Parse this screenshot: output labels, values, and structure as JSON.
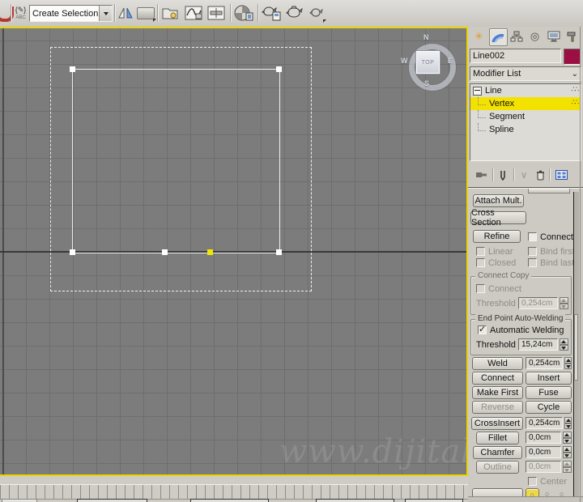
{
  "toolbar": {
    "selection_set_value": "Create Selection Se"
  },
  "viewport": {
    "viewcube": {
      "center": "TOP",
      "north": "N",
      "east": "E",
      "south": "S",
      "west": "W"
    },
    "watermark": "www.dijitalde"
  },
  "panel": {
    "object_name": "Line002",
    "object_color": "#9b0f42",
    "modifier_list": "Modifier List",
    "stack": {
      "root": "Line",
      "items": [
        {
          "label": "Vertex"
        },
        {
          "label": "Segment"
        },
        {
          "label": "Spline"
        }
      ],
      "selected": "Vertex"
    },
    "rollout": {
      "attach_mult": "Attach Mult.",
      "cross_section": "Cross Section",
      "refine": "Refine",
      "connect_checkbox": "Connect",
      "linear": "Linear",
      "closed": "Closed",
      "bind_first": "Bind first",
      "bind_last": "Bind last",
      "connect_copy": {
        "title": "Connect Copy",
        "connect": "Connect",
        "threshold": "Threshold",
        "value": "0,254cm"
      },
      "auto_weld": {
        "title": "End Point Auto-Welding",
        "checkbox": "Automatic Welding",
        "threshold": "Threshold",
        "value": "15,24cm"
      },
      "weld": "Weld",
      "weld_value": "0,254cm",
      "connect_button": "Connect",
      "insert": "Insert",
      "make_first": "Make First",
      "fuse": "Fuse",
      "reverse": "Reverse",
      "cycle": "Cycle",
      "cross_insert": "CrossInsert",
      "cross_insert_value": "0,254cm",
      "fillet": "Fillet",
      "fillet_value": "0,0cm",
      "chamfer": "Chamfer",
      "chamfer_value": "0,0cm",
      "outline": "Outline",
      "outline_value": "0,0cm",
      "center": "Center"
    }
  }
}
